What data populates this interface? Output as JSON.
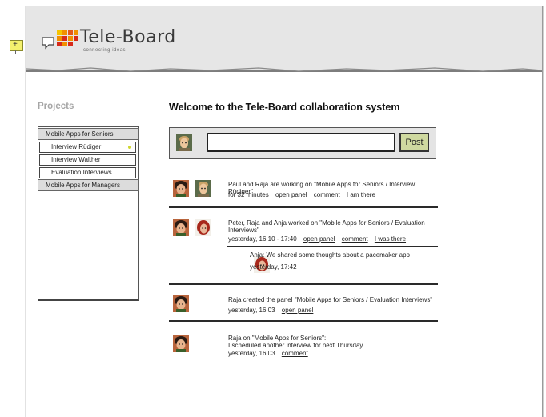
{
  "logo": {
    "name": "Tele-Board",
    "tagline": "connecting ideas"
  },
  "add_button": {
    "label": "+"
  },
  "sidebar": {
    "title": "Projects",
    "items": [
      {
        "label": "Mobile Apps for Seniors",
        "type": "group"
      },
      {
        "label": "Interview Rüdiger",
        "type": "item",
        "active": true
      },
      {
        "label": "Interview Walther",
        "type": "item"
      },
      {
        "label": "Evaluation Interviews",
        "type": "item"
      },
      {
        "label": "Mobile Apps for Managers",
        "type": "group"
      }
    ]
  },
  "main": {
    "welcome": "Welcome to the Tele-Board collaboration system",
    "post": {
      "input_value": "",
      "button_label": "Post"
    },
    "activities": [
      {
        "text": "Paul and Raja are working on \"Mobile Apps for Seniors / Interview Rüdiger\"",
        "time": "for 32 minutes",
        "links": [
          "open panel",
          "comment",
          "I am there"
        ]
      },
      {
        "text": "Peter, Raja and Anja worked on \"Mobile Apps for Seniors / Evaluation Interviews\"",
        "time": "yesterday, 16:10 - 17:40",
        "links": [
          "open panel",
          "comment",
          "I was there"
        ],
        "comment": {
          "text": "Anja: We shared some thoughts about a pacemaker app",
          "time": "yesterday, 17:42"
        }
      },
      {
        "text": "Raja created the panel \"Mobile Apps for Seniors / Evaluation Interviews\"",
        "time": "yesterday, 16:03",
        "links": [
          "open panel"
        ]
      },
      {
        "text_line1": "Raja on \"Mobile Apps for Seniors\":",
        "text_line2": "I scheduled another interview for next Thursday",
        "time": "yesterday, 16:03",
        "links": [
          "comment"
        ]
      }
    ]
  },
  "colors": {
    "header_bg": "#e6e6e6",
    "post_button": "#cfd9a0",
    "status_dot": "#cfd630",
    "add_button": "#f4f16e",
    "logo_red": "#d72a1a",
    "logo_orange": "#f29000"
  }
}
